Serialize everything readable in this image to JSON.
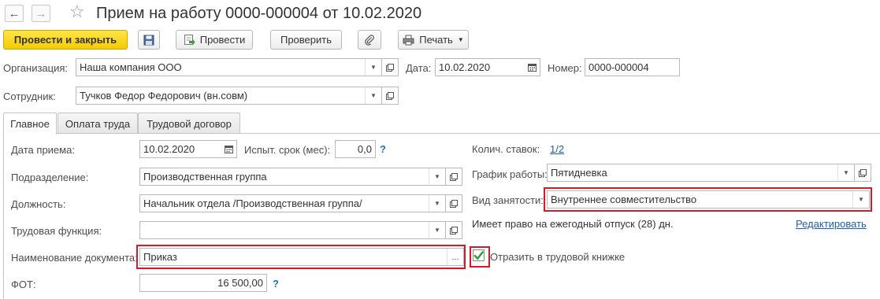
{
  "window": {
    "title": "Прием на работу 0000-000004 от 10.02.2020"
  },
  "toolbar": {
    "post_and_close": "Провести и закрыть",
    "post": "Провести",
    "check": "Проверить",
    "print": "Печать"
  },
  "header": {
    "organization_label": "Организация:",
    "organization_value": "Наша компания ООО",
    "date_label": "Дата:",
    "date_value": "10.02.2020",
    "number_label": "Номер:",
    "number_value": "0000-000004",
    "employee_label": "Сотрудник:",
    "employee_value": "Тучков Федор Федорович (вн.совм)"
  },
  "tabs": [
    {
      "label": "Главное"
    },
    {
      "label": "Оплата труда"
    },
    {
      "label": "Трудовой договор"
    }
  ],
  "main": {
    "hire_date_label": "Дата приема:",
    "hire_date_value": "10.02.2020",
    "probation_label": "Испыт. срок (мес):",
    "probation_value": "0,0",
    "department_label": "Подразделение:",
    "department_value": "Производственная группа",
    "position_label": "Должность:",
    "position_value": "Начальник отдела /Производственная группа/",
    "labor_function_label": "Трудовая функция:",
    "labor_function_value": "",
    "document_name_label": "Наименование документа:",
    "document_name_value": "Приказ",
    "payroll_label": "ФОТ:",
    "payroll_value": "16 500,00",
    "rates_label": "Колич. ставок:",
    "rates_value": "1/2",
    "schedule_label": "График работы:",
    "schedule_value": "Пятидневка",
    "employment_type_label": "Вид занятости:",
    "employment_type_value": "Внутреннее совместительство",
    "vacation_text": "Имеет право на ежегодный отпуск (28) дн.",
    "edit_link": "Редактировать",
    "workbook_checkbox_label": "Отразить в трудовой книжке",
    "workbook_checked": true,
    "help_mark": "?"
  },
  "colors": {
    "primary_button": "#f3cc00",
    "highlight": "#d01c2a",
    "link": "#1d5fa8"
  }
}
